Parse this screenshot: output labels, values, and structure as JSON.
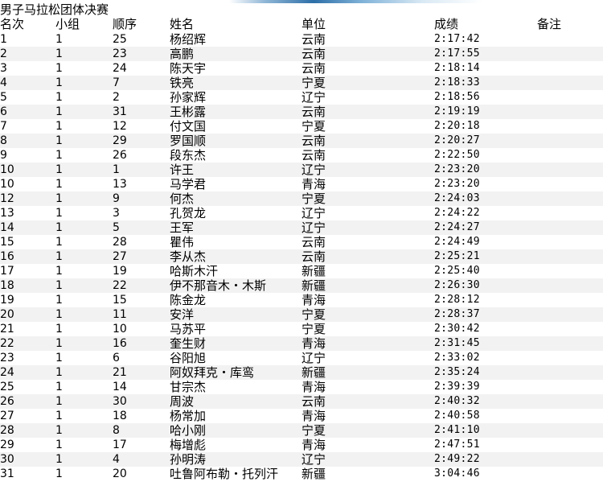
{
  "title": "男子马拉松团体决赛",
  "columns": {
    "rank": "名次",
    "group": "小组",
    "order": "顺序",
    "name": "姓名",
    "unit": "单位",
    "time": "成绩",
    "note": "备注"
  },
  "rows": [
    {
      "rank": "1",
      "group": "1",
      "order": "25",
      "name": "杨绍辉",
      "unit": "云南",
      "time": "2:17:42"
    },
    {
      "rank": "2",
      "group": "1",
      "order": "23",
      "name": "高鹏",
      "unit": "云南",
      "time": "2:17:55"
    },
    {
      "rank": "3",
      "group": "1",
      "order": "24",
      "name": "陈天宇",
      "unit": "云南",
      "time": "2:18:14"
    },
    {
      "rank": "4",
      "group": "1",
      "order": "7",
      "name": "铁亮",
      "unit": "宁夏",
      "time": "2:18:33"
    },
    {
      "rank": "5",
      "group": "1",
      "order": "2",
      "name": "孙家辉",
      "unit": "辽宁",
      "time": "2:18:56"
    },
    {
      "rank": "6",
      "group": "1",
      "order": "31",
      "name": "王彬露",
      "unit": "云南",
      "time": "2:19:19"
    },
    {
      "rank": "7",
      "group": "1",
      "order": "12",
      "name": "付文国",
      "unit": "宁夏",
      "time": "2:20:18"
    },
    {
      "rank": "8",
      "group": "1",
      "order": "29",
      "name": "罗国顺",
      "unit": "云南",
      "time": "2:20:27"
    },
    {
      "rank": "9",
      "group": "1",
      "order": "26",
      "name": "段东杰",
      "unit": "云南",
      "time": "2:22:50"
    },
    {
      "rank": "10",
      "group": "1",
      "order": "1",
      "name": "许王",
      "unit": "辽宁",
      "time": "2:23:20"
    },
    {
      "rank": "10",
      "group": "1",
      "order": "13",
      "name": "马学君",
      "unit": "青海",
      "time": "2:23:20"
    },
    {
      "rank": "12",
      "group": "1",
      "order": "9",
      "name": "何杰",
      "unit": "宁夏",
      "time": "2:24:03"
    },
    {
      "rank": "13",
      "group": "1",
      "order": "3",
      "name": "孔贺龙",
      "unit": "辽宁",
      "time": "2:24:22"
    },
    {
      "rank": "14",
      "group": "1",
      "order": "5",
      "name": "王军",
      "unit": "辽宁",
      "time": "2:24:27"
    },
    {
      "rank": "15",
      "group": "1",
      "order": "28",
      "name": "瞿伟",
      "unit": "云南",
      "time": "2:24:49"
    },
    {
      "rank": "16",
      "group": "1",
      "order": "27",
      "name": "李从杰",
      "unit": "云南",
      "time": "2:25:21"
    },
    {
      "rank": "17",
      "group": "1",
      "order": "19",
      "name": "哈斯木汗",
      "unit": "新疆",
      "time": "2:25:40"
    },
    {
      "rank": "18",
      "group": "1",
      "order": "22",
      "name": "伊不那音木・木斯",
      "unit": "新疆",
      "time": "2:26:30"
    },
    {
      "rank": "19",
      "group": "1",
      "order": "15",
      "name": "陈金龙",
      "unit": "青海",
      "time": "2:28:12"
    },
    {
      "rank": "20",
      "group": "1",
      "order": "11",
      "name": "安洋",
      "unit": "宁夏",
      "time": "2:28:37"
    },
    {
      "rank": "21",
      "group": "1",
      "order": "10",
      "name": "马苏平",
      "unit": "宁夏",
      "time": "2:30:42"
    },
    {
      "rank": "22",
      "group": "1",
      "order": "16",
      "name": "奎生财",
      "unit": "青海",
      "time": "2:31:45"
    },
    {
      "rank": "23",
      "group": "1",
      "order": "6",
      "name": "谷阳旭",
      "unit": "辽宁",
      "time": "2:33:02"
    },
    {
      "rank": "24",
      "group": "1",
      "order": "21",
      "name": "阿奴拜克・库鸾",
      "unit": "新疆",
      "time": "2:35:24"
    },
    {
      "rank": "25",
      "group": "1",
      "order": "14",
      "name": "甘宗杰",
      "unit": "青海",
      "time": "2:39:39"
    },
    {
      "rank": "26",
      "group": "1",
      "order": "30",
      "name": "周波",
      "unit": "云南",
      "time": "2:40:32"
    },
    {
      "rank": "27",
      "group": "1",
      "order": "18",
      "name": "杨常加",
      "unit": "青海",
      "time": "2:40:58"
    },
    {
      "rank": "28",
      "group": "1",
      "order": "8",
      "name": "哈小刚",
      "unit": "宁夏",
      "time": "2:41:10"
    },
    {
      "rank": "29",
      "group": "1",
      "order": "17",
      "name": "梅增彪",
      "unit": "青海",
      "time": "2:47:51"
    },
    {
      "rank": "30",
      "group": "1",
      "order": "4",
      "name": "孙明涛",
      "unit": "辽宁",
      "time": "2:49:22"
    },
    {
      "rank": "31",
      "group": "1",
      "order": "20",
      "name": "吐鲁阿布勒・托列汗",
      "unit": "新疆",
      "time": "3:04:46"
    }
  ]
}
